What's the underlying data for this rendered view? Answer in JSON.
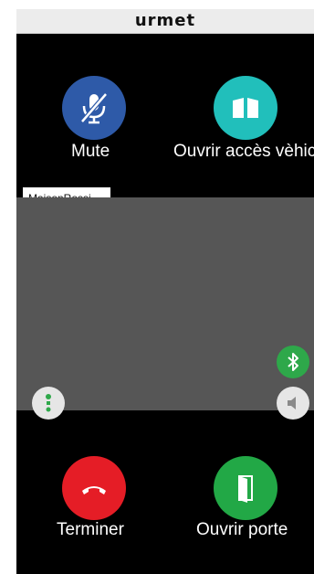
{
  "header": {
    "brand": "urmet"
  },
  "caller": {
    "name": "MaisonRossi"
  },
  "actions": {
    "mute_label": "Mute",
    "vehicle_label": "Ouvrir accès vèhicule",
    "end_label": "Terminer",
    "door_label": "Ouvrir porte"
  },
  "icons": {
    "mute": "microphone-off-icon",
    "vehicle": "gate-icon",
    "end": "phone-hangup-icon",
    "door": "door-open-icon",
    "bluetooth": "bluetooth-icon",
    "speaker": "speaker-icon",
    "menu": "vertical-dots-icon"
  },
  "colors": {
    "mute": "#2e5aa8",
    "vehicle": "#21bfbb",
    "end": "#e51d26",
    "door": "#22a846",
    "bluetooth": "#2ea84a",
    "speaker": "#e6e6e6",
    "menu": "#e6e6e6",
    "video_bg": "#565656"
  }
}
